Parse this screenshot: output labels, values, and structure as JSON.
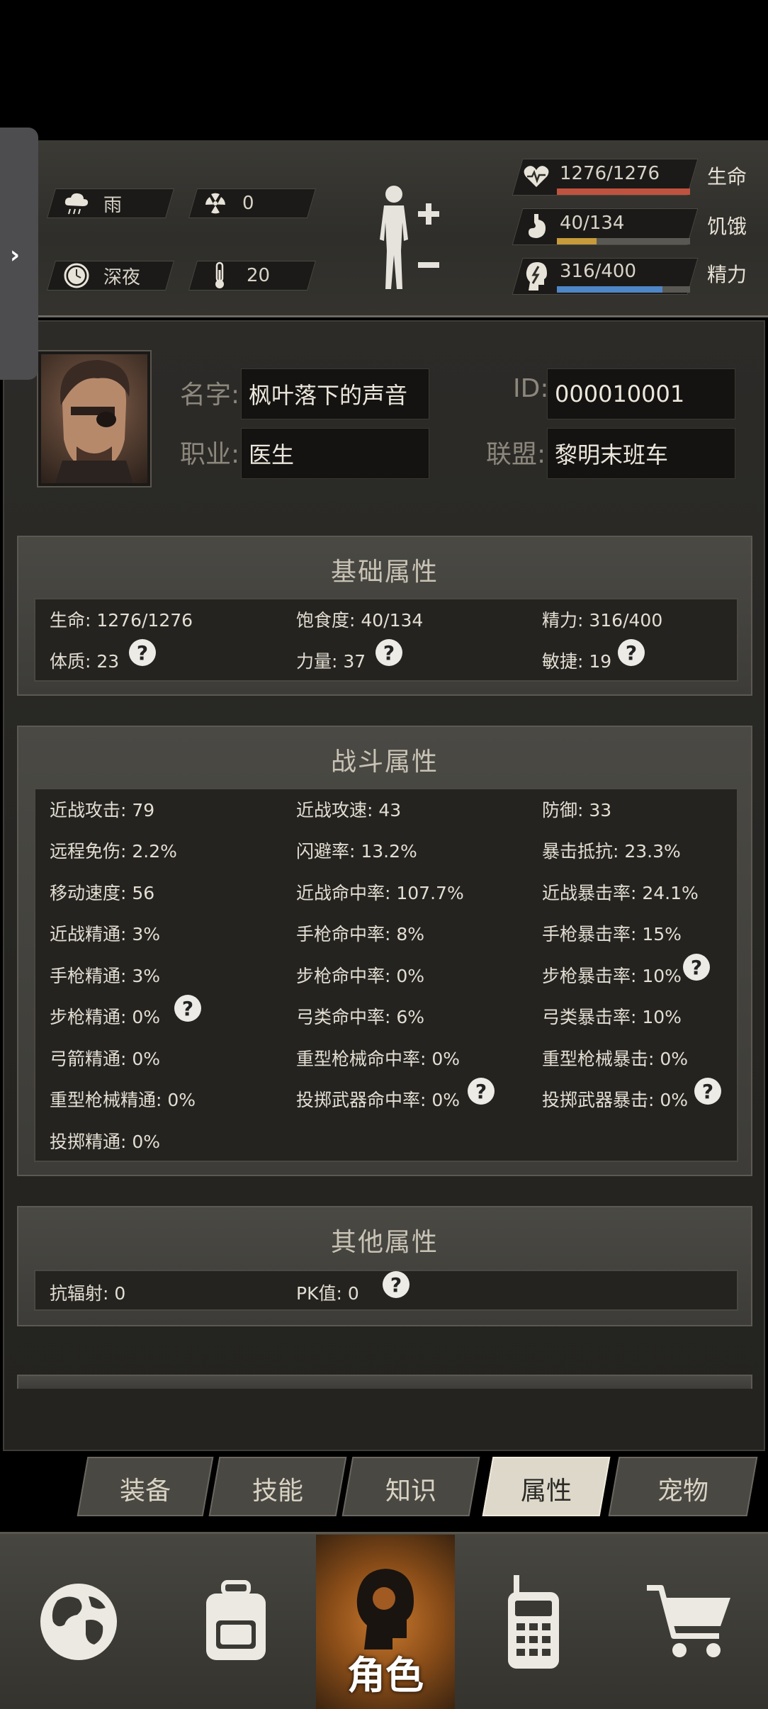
{
  "status": {
    "weather": {
      "icon": "rain-cloud-icon",
      "label": "雨"
    },
    "radiation": {
      "icon": "radiation-icon",
      "value": "0"
    },
    "time": {
      "icon": "clock-icon",
      "label": "深夜"
    },
    "temperature": {
      "icon": "thermometer-icon",
      "value": "20"
    },
    "vitals": [
      {
        "icon": "heartbeat-icon",
        "value": "1276/1276",
        "label": "生命",
        "fraction": 1.0,
        "color": "#c0533f"
      },
      {
        "icon": "stomach-icon",
        "value": "40/134",
        "label": "饥饿",
        "fraction": 0.2985,
        "color": "#c79a3c"
      },
      {
        "icon": "head-energy-icon",
        "value": "316/400",
        "label": "精力",
        "fraction": 0.79,
        "color": "#4f86c6"
      }
    ]
  },
  "drawer": {
    "arrow": "›"
  },
  "profile": {
    "name_label": "名字:",
    "name": "枫叶落下的声音",
    "id_label": "ID:",
    "id": "000010001",
    "job_label": "职业:",
    "job": "医生",
    "alliance_label": "联盟:",
    "alliance": "黎明末班车"
  },
  "basic": {
    "title": "基础属性",
    "row1": [
      "生命: 1276/1276",
      "饱食度: 40/134",
      "精力: 316/400"
    ],
    "row2": [
      "体质: 23",
      "力量: 37",
      "敏捷: 19"
    ]
  },
  "combat": {
    "title": "战斗属性",
    "rows": [
      [
        "近战攻击: 79",
        "近战攻速: 43",
        "防御: 33"
      ],
      [
        "远程免伤: 2.2%",
        "闪避率: 13.2%",
        "暴击抵抗: 23.3%"
      ],
      [
        "移动速度: 56",
        "近战命中率: 107.7%",
        "近战暴击率: 24.1%"
      ],
      [
        "近战精通: 3%",
        "手枪命中率: 8%",
        "手枪暴击率: 15%"
      ],
      [
        "手枪精通: 3%",
        "步枪命中率: 0%",
        "步枪暴击率: 10%"
      ],
      [
        "步枪精通: 0%",
        "弓类命中率: 6%",
        "弓类暴击率: 10%"
      ],
      [
        "弓箭精通: 0%",
        "重型枪械命中率: 0%",
        "重型枪械暴击: 0%"
      ],
      [
        "重型枪械精通: 0%",
        "投掷武器命中率: 0%",
        "投掷武器暴击: 0%"
      ],
      [
        "投掷精通: 0%",
        "",
        ""
      ]
    ]
  },
  "other": {
    "title": "其他属性",
    "items": [
      "抗辐射: 0",
      "PK值: 0"
    ]
  },
  "help_mark": "?",
  "tabs": [
    {
      "label": "装备",
      "active": false
    },
    {
      "label": "技能",
      "active": false
    },
    {
      "label": "知识",
      "active": false
    },
    {
      "label": "属性",
      "active": true
    },
    {
      "label": "宠物",
      "active": false
    }
  ],
  "bottom_nav": [
    {
      "icon": "globe-icon",
      "label": ""
    },
    {
      "icon": "backpack-icon",
      "label": ""
    },
    {
      "icon": "character-head-icon",
      "label": "角色"
    },
    {
      "icon": "walkie-talkie-icon",
      "label": ""
    },
    {
      "icon": "shopping-cart-icon",
      "label": ""
    }
  ]
}
